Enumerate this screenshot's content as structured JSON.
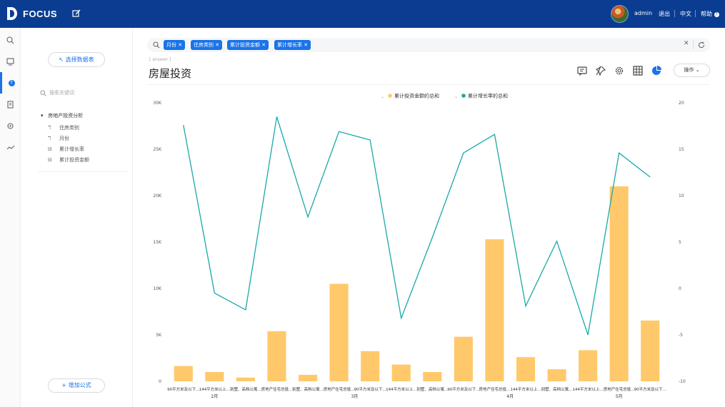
{
  "app": {
    "logo_text": "FOCUS",
    "user": "admin",
    "logout": "退出",
    "language": "中文",
    "help": "帮助"
  },
  "sidebar_icons": [
    "search-icon",
    "dashboard-icon",
    "question-icon",
    "data-icon",
    "settings-icon",
    "trend-icon"
  ],
  "panel": {
    "select_dataset": "选择数据表",
    "search_placeholder": "搜索关键词",
    "root": "房地产投资分析",
    "items": [
      {
        "icon": "dimension-icon",
        "label": "住房类别"
      },
      {
        "icon": "dimension-icon",
        "label": "月份"
      },
      {
        "icon": "measure-icon",
        "label": "累计增长率"
      },
      {
        "icon": "measure-icon",
        "label": "累计投资金额"
      }
    ],
    "add_formula": "增加公式"
  },
  "search": {
    "tags": [
      "月份",
      "住房类别",
      "累计投资金额",
      "累计增长率"
    ]
  },
  "title": "房屋投资",
  "answer_label": "[ answer ]",
  "operation": "操作",
  "colors": {
    "bar": "#ffc96b",
    "line": "#1aa8a8",
    "accent": "#1a73e8",
    "topbar": "#0a3d91"
  },
  "chart_data": {
    "type": "bar",
    "categories": [
      "90平方米及以下...",
      "144平方米以上...",
      "别墅、高档公寓...",
      "房地产住宅总投...",
      "别墅、高档公寓...",
      "房地产住宅总投...",
      "90平方米及以下...",
      "144平方米以上...",
      "别墅、高档公寓...",
      "90平方米及以下...",
      "房地产住宅总投...",
      "144平方米以上...",
      "别墅、高档公寓...",
      "144平方米以上...",
      "房地产住宅总投...",
      "90平方米及以下..."
    ],
    "groups": [
      {
        "label": "2月",
        "start": 0,
        "end": 2
      },
      {
        "label": "3月",
        "start": 3,
        "end": 8
      },
      {
        "label": "4月",
        "start": 9,
        "end": 12
      },
      {
        "label": "5月",
        "start": 13,
        "end": 15
      }
    ],
    "series": [
      {
        "name": "累计投资金额的总和",
        "type": "bar",
        "axis": "left",
        "values": [
          1650,
          1000,
          400,
          5400,
          700,
          10500,
          3250,
          1800,
          1000,
          4800,
          15300,
          2600,
          1300,
          3350,
          21000,
          6550
        ]
      },
      {
        "name": "累计增长率的总和",
        "type": "line",
        "axis": "right",
        "values": [
          17.6,
          -0.5,
          -2.3,
          18.5,
          7.7,
          16.9,
          16.0,
          -3.2,
          5.5,
          14.6,
          16.6,
          -1.9,
          5.1,
          -5.0,
          14.6,
          12.0
        ]
      }
    ],
    "ylim": [
      0,
      30000
    ],
    "yticks": [
      "0",
      "5K",
      "10K",
      "15K",
      "20K",
      "25K",
      "30K"
    ],
    "y2lim": [
      -10,
      20
    ],
    "y2ticks": [
      "-10",
      "-5",
      "0",
      "5",
      "10",
      "15",
      "20"
    ],
    "legend_position": "top-center",
    "grid": false
  }
}
